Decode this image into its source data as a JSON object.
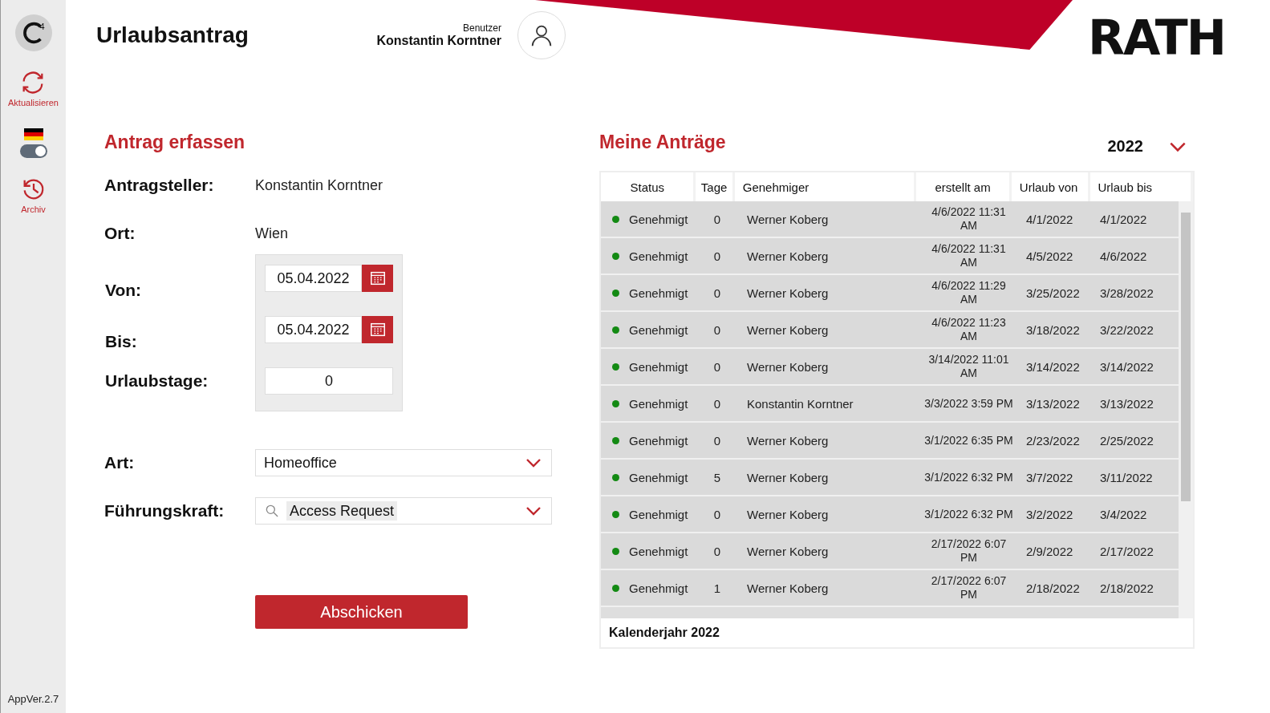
{
  "sidebar": {
    "logo_mark": "4",
    "items": [
      {
        "kind": "refresh",
        "label": "Aktualisieren"
      },
      {
        "kind": "language",
        "on": true
      },
      {
        "kind": "archive",
        "label": "Archiv"
      }
    ],
    "version": "AppVer.2.7"
  },
  "header": {
    "title": "Urlaubsantrag",
    "user_caption": "Benutzer",
    "user_name": "Konstantin Korntner",
    "logo": "RATH"
  },
  "form": {
    "heading": "Antrag erfassen",
    "applicant": {
      "label": "Antragsteller:",
      "value": "Konstantin Korntner"
    },
    "location": {
      "label": "Ort:",
      "value": "Wien"
    },
    "from": {
      "label": "Von:",
      "value": "05.04.2022"
    },
    "to": {
      "label": "Bis:",
      "value": "05.04.2022"
    },
    "days": {
      "label": "Urlaubstage:",
      "value": "0"
    },
    "type": {
      "label": "Art:",
      "value": "Homeoffice"
    },
    "manager": {
      "label": "Führungskraft:",
      "value": "Access Request"
    },
    "submit": "Abschicken"
  },
  "requests": {
    "heading": "Meine Anträge",
    "year": "2022",
    "columns": [
      "Status",
      "Tage",
      "Genehmiger",
      "erstellt am",
      "Urlaub von",
      "Urlaub bis"
    ],
    "rows": [
      {
        "color": "#138a13",
        "cells": [
          "Genehmigt",
          "0",
          "Werner Koberg",
          "4/6/2022 11:31 AM",
          "4/1/2022",
          "4/1/2022"
        ]
      },
      {
        "color": "#138a13",
        "cells": [
          "Genehmigt",
          "0",
          "Werner Koberg",
          "4/6/2022 11:31 AM",
          "4/5/2022",
          "4/6/2022"
        ]
      },
      {
        "color": "#138a13",
        "cells": [
          "Genehmigt",
          "0",
          "Werner Koberg",
          "4/6/2022 11:29 AM",
          "3/25/2022",
          "3/28/2022"
        ]
      },
      {
        "color": "#138a13",
        "cells": [
          "Genehmigt",
          "0",
          "Werner Koberg",
          "4/6/2022 11:23 AM",
          "3/18/2022",
          "3/22/2022"
        ]
      },
      {
        "color": "#138a13",
        "cells": [
          "Genehmigt",
          "0",
          "Werner Koberg",
          "3/14/2022 11:01 AM",
          "3/14/2022",
          "3/14/2022"
        ]
      },
      {
        "color": "#138a13",
        "cells": [
          "Genehmigt",
          "0",
          "Konstantin Korntner",
          "3/3/2022 3:59 PM",
          "3/13/2022",
          "3/13/2022"
        ]
      },
      {
        "color": "#138a13",
        "cells": [
          "Genehmigt",
          "0",
          "Werner Koberg",
          "3/1/2022 6:35 PM",
          "2/23/2022",
          "2/25/2022"
        ]
      },
      {
        "color": "#138a13",
        "cells": [
          "Genehmigt",
          "5",
          "Werner Koberg",
          "3/1/2022 6:32 PM",
          "3/7/2022",
          "3/11/2022"
        ]
      },
      {
        "color": "#138a13",
        "cells": [
          "Genehmigt",
          "0",
          "Werner Koberg",
          "3/1/2022 6:32 PM",
          "3/2/2022",
          "3/4/2022"
        ]
      },
      {
        "color": "#138a13",
        "cells": [
          "Genehmigt",
          "0",
          "Werner Koberg",
          "2/17/2022 6:07 PM",
          "2/9/2022",
          "2/17/2022"
        ]
      },
      {
        "color": "#138a13",
        "cells": [
          "Genehmigt",
          "1",
          "Werner Koberg",
          "2/17/2022 6:07 PM",
          "2/18/2022",
          "2/18/2022"
        ]
      }
    ],
    "footer": "Kalenderjahr 2022"
  }
}
